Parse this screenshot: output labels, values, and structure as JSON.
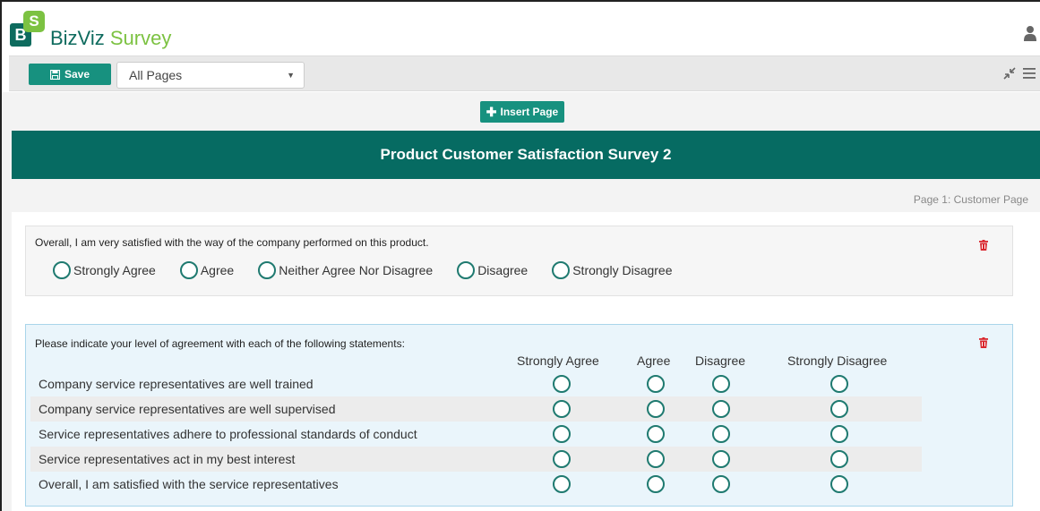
{
  "app": {
    "logo_b": "B",
    "logo_s": "S",
    "brand_part1": "BizViz",
    "brand_part2": "Survey",
    "user_icon": "user-icon"
  },
  "toolbar": {
    "save_label": "Save",
    "save_icon": "floppy-disk-icon",
    "page_select_value": "All Pages",
    "compress_icon": "compress-icon",
    "menu_icon": "hamburger-menu-icon"
  },
  "canvas": {
    "insert_page_label": "Insert Page",
    "survey_title": "Product Customer Satisfaction Survey 2",
    "page_label": "Page 1:  Customer Page"
  },
  "question1": {
    "text": "Overall, I am very satisfied with the way of the company performed on this product.",
    "options": [
      "Strongly Agree",
      "Agree",
      "Neither Agree Nor Disagree",
      "Disagree",
      "Strongly Disagree"
    ]
  },
  "question2": {
    "text": "Please indicate your level of agreement with each of the following statements:",
    "columns": [
      "Strongly Agree",
      "Agree",
      "Disagree",
      "Strongly Disagree"
    ],
    "rows": [
      "Company service representatives are well trained",
      "Company service representatives are well supervised",
      "Service representatives adhere to professional standards of conduct",
      "Service representatives act in my best interest",
      "Overall, I am satisfied with the service representatives"
    ]
  },
  "colors": {
    "primary_teal": "#066b62",
    "button_teal": "#17917f",
    "brand_green": "#7cc242",
    "delete_red": "#d9272e"
  }
}
